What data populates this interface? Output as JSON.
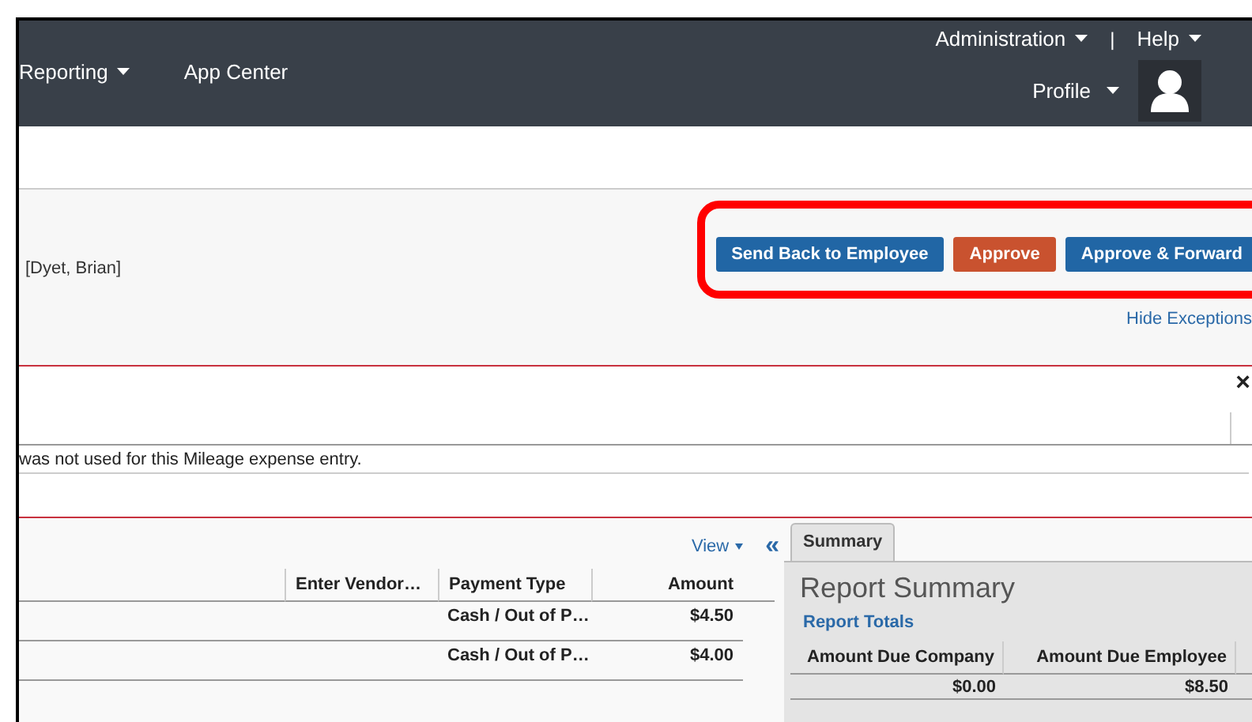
{
  "nav": {
    "items": [
      {
        "label": "Reporting",
        "dropdown": true
      },
      {
        "label": "App Center",
        "dropdown": false
      }
    ],
    "utility": [
      {
        "label": "Administration",
        "dropdown": true
      },
      {
        "label": "Help",
        "dropdown": true
      }
    ],
    "separator": "|",
    "profile": {
      "label": "Profile",
      "dropdown": true
    }
  },
  "report": {
    "employee": "[Dyet, Brian]",
    "highlighted": true,
    "actions": [
      {
        "label": "Send Back to Employee",
        "kind": "primary"
      },
      {
        "label": "Approve",
        "kind": "approve"
      },
      {
        "label": "Approve & Forward",
        "kind": "primary"
      }
    ],
    "link": "Hide Exceptions"
  },
  "exceptions": {
    "close": "×",
    "message": "was not used for this Mileage expense entry."
  },
  "expenses": {
    "view": "View",
    "collapse": "«",
    "columns": [
      "Enter Vendor…",
      "Payment Type",
      "Amount"
    ],
    "rows": [
      {
        "payment": "Cash / Out of P…",
        "amount": "$4.50"
      },
      {
        "payment": "Cash / Out of P…",
        "amount": "$4.00"
      }
    ]
  },
  "summary": {
    "tabs": [
      {
        "label": "Summary",
        "selected": true
      }
    ],
    "title": "Report Summary",
    "section": "Report Totals",
    "columns": [
      "Amount Due Company",
      "Amount Due Employee"
    ],
    "values": [
      "$0.00",
      "$8.50"
    ]
  }
}
